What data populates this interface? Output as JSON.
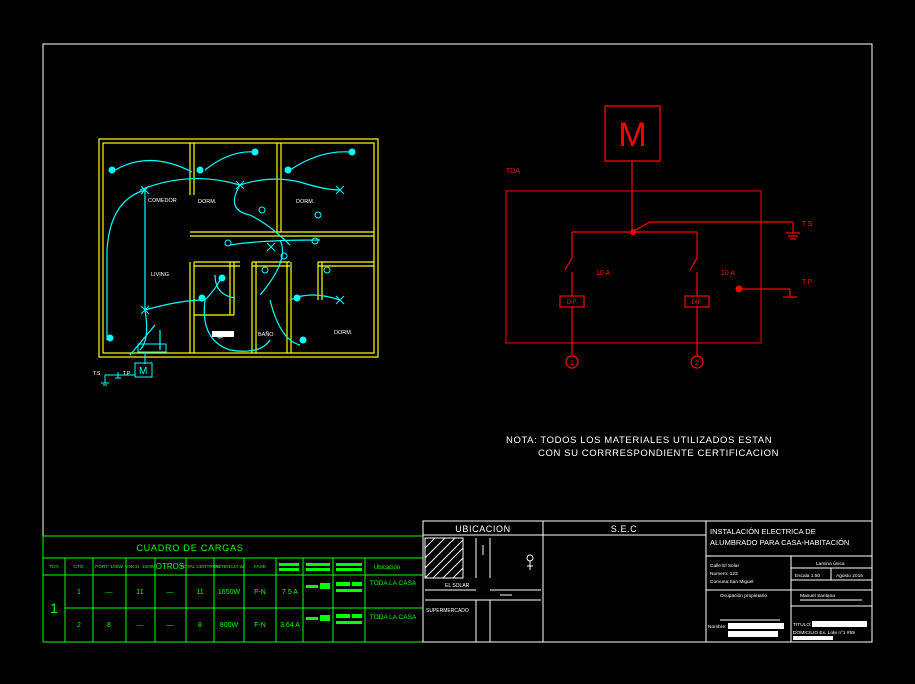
{
  "colors": {
    "background": "#000000",
    "frame": "#ffffff",
    "walls": "#ffff00",
    "circuit": "#00ffff",
    "panel": "#ff0000",
    "table": "#00ff00"
  },
  "floor_plan": {
    "rooms": [
      "COMEDOR",
      "DORM.",
      "DORM.",
      "LIVING",
      "BAÑO",
      "DORM."
    ],
    "meter_label": "M",
    "ts_label": "T.S",
    "tp_label": "T.P"
  },
  "panel_diagram": {
    "meter_label": "M",
    "tda_label": "TDA",
    "ts_label": "T.S",
    "tp_label": "T.P",
    "breakers": [
      "10 A",
      "10 A"
    ],
    "dif_labels": [
      "DIF.",
      "DIF."
    ],
    "circuit_numbers": [
      "1",
      "2"
    ]
  },
  "note": {
    "line1": "NOTA: TODOS LOS MATERIALES UTILIZADOS ESTAN",
    "line2": "CON SU CORRRESPONDIENTE CERTIFICACION"
  },
  "load_table": {
    "title": "CUADRO DE CARGAS",
    "headers": [
      "TDA",
      "CTO.",
      "PORT. 100W",
      "ENCH. 150W",
      "OTROS",
      "TOTAL CENTROS",
      "POTENCIA W",
      "FASE",
      "",
      "",
      "",
      "Ubicación"
    ],
    "group": "1",
    "rows": [
      {
        "cto": "1",
        "port": "—",
        "ench": "11",
        "otros": "—",
        "total": "11",
        "potencia": "1650W",
        "fase": "F-N",
        "amp": "7.5 A",
        "ubicacion": "TODA LA CASA"
      },
      {
        "cto": "2",
        "port": "8",
        "ench": "—",
        "otros": "—",
        "total": "8",
        "potencia": "800W",
        "fase": "F-N",
        "amp": "3.64 A",
        "ubicacion": "TODA LA CASA"
      }
    ]
  },
  "location": {
    "title": "UBICACION",
    "street1": "EL SOLAR",
    "street2": "SUPERMERCADO"
  },
  "sec": {
    "title": "S.E.C"
  },
  "title_block": {
    "title_line1": "INSTALACIÓN ELECTRICA DE",
    "title_line2": "ALUMBRADO PARA CASA-HABITACIÓN",
    "address_line1": "Calle:El Solar",
    "address_line2": "Numero: 123",
    "address_line3": "Comuna:San Miguel",
    "lamina": "Lamina única",
    "escala": "Escala 1:50",
    "fecha": "Agosto 2015",
    "owner_label": "Ocupación propietario",
    "owner_name": "Manuel Santana",
    "nombre_label": "Nombre:",
    "titulo_label": "TITULO:",
    "domicilio_label": "DOMICILIO Ex. Lote n°1 #59"
  }
}
